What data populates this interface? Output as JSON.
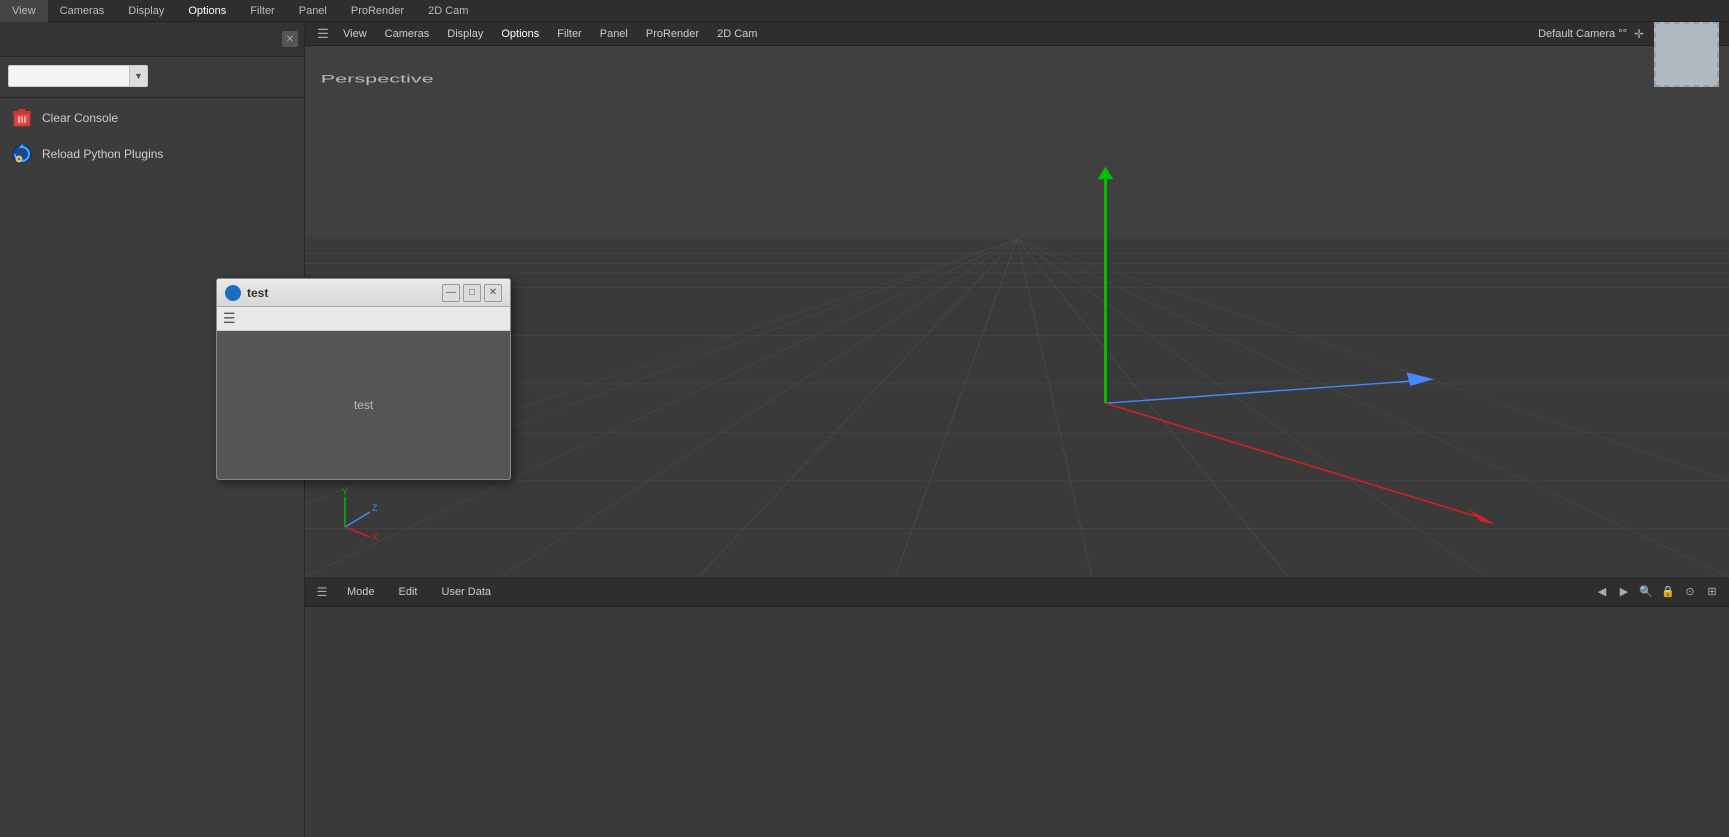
{
  "topbar": {
    "tabs": [
      "View",
      "Cameras",
      "Display",
      "Options",
      "Filter",
      "Panel",
      "ProRender",
      "2D Cam"
    ]
  },
  "leftpanel": {
    "search_placeholder": "",
    "menu_items": [
      {
        "id": "clear-console",
        "label": "Clear Console",
        "icon": "trash"
      },
      {
        "id": "reload-python",
        "label": "Reload Python Plugins",
        "icon": "reload"
      }
    ]
  },
  "viewport": {
    "menu_items": [
      "View",
      "Cameras",
      "Display",
      "Options",
      "Filter",
      "Panel",
      "ProRender",
      "2D Cam"
    ],
    "label_perspective": "Perspective",
    "label_camera": "Default Camera °°"
  },
  "dialog": {
    "title": "test",
    "content_text": "test",
    "buttons": {
      "minimize": "—",
      "maximize": "□",
      "close": "✕"
    }
  },
  "props_panel": {
    "menu_items": [
      "Mode",
      "Edit",
      "User Data"
    ]
  }
}
